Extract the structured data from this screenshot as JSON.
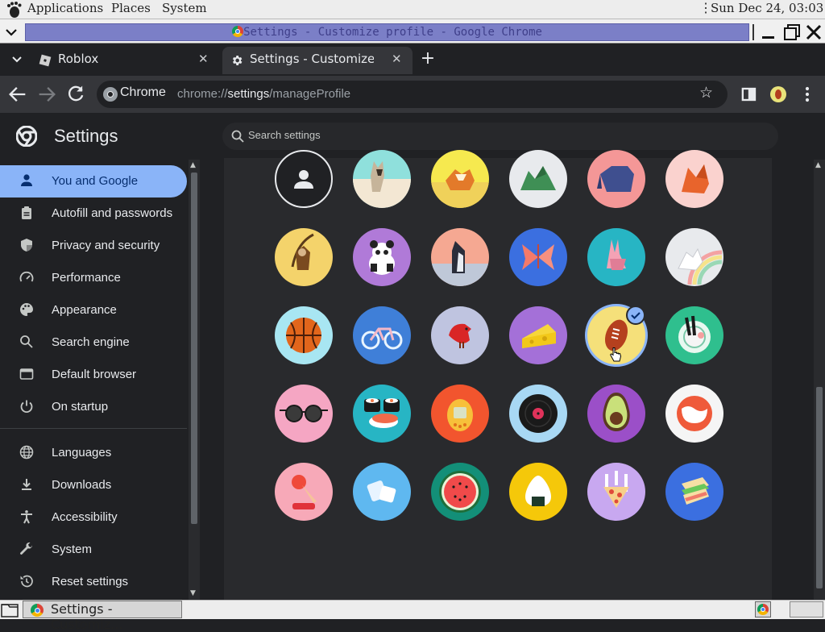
{
  "top_panel": {
    "applications": "Applications",
    "places": "Places",
    "system": "System",
    "clock": "Sun Dec 24, 03:03"
  },
  "window": {
    "title": "Settings - Customize profile - Google Chrome"
  },
  "tabs": [
    {
      "label": "Roblox"
    },
    {
      "label": "Settings - Customize p"
    }
  ],
  "toolbar": {
    "chip_label": "Chrome",
    "url_prefix": "chrome://",
    "url_host": "settings",
    "url_path": "/manageProfile"
  },
  "settings": {
    "title": "Settings",
    "search_placeholder": "Search settings"
  },
  "sidebar": {
    "items": [
      {
        "label": "You and Google",
        "icon": "person-icon"
      },
      {
        "label": "Autofill and passwords",
        "icon": "clipboard-icon"
      },
      {
        "label": "Privacy and security",
        "icon": "shield-icon"
      },
      {
        "label": "Performance",
        "icon": "speedometer-icon"
      },
      {
        "label": "Appearance",
        "icon": "palette-icon"
      },
      {
        "label": "Search engine",
        "icon": "search-icon"
      },
      {
        "label": "Default browser",
        "icon": "browser-icon"
      },
      {
        "label": "On startup",
        "icon": "power-icon"
      },
      {
        "label": "Languages",
        "icon": "globe-icon"
      },
      {
        "label": "Downloads",
        "icon": "download-icon"
      },
      {
        "label": "Accessibility",
        "icon": "accessibility-icon"
      },
      {
        "label": "System",
        "icon": "wrench-icon"
      },
      {
        "label": "Reset settings",
        "icon": "history-icon"
      }
    ]
  },
  "avatars": {
    "selected": "football",
    "rows": [
      [
        "generic-person",
        "origami-cat",
        "origami-corgi",
        "origami-dragon",
        "origami-elephant",
        "origami-fox"
      ],
      [
        "origami-monkey",
        "origami-panda",
        "origami-penguin",
        "origami-butterfly",
        "origami-rabbit",
        "origami-unicorn"
      ],
      [
        "basketball",
        "bicycle",
        "bird",
        "cheese",
        "football",
        "ramen"
      ],
      [
        "sunglasses",
        "sushi",
        "tamagotchi",
        "vinyl-record",
        "avocado",
        "smiley"
      ],
      [
        "ice-cream",
        "cube",
        "watermelon",
        "onigiri",
        "pizza",
        "sandwich"
      ]
    ]
  },
  "taskbar": {
    "task_label": "Settings - Customiz..."
  },
  "colors": {
    "accent": "#8ab4f8",
    "page_bg": "#202124",
    "card_bg": "#292a2d",
    "selected_ring": "#8ab4f8"
  }
}
